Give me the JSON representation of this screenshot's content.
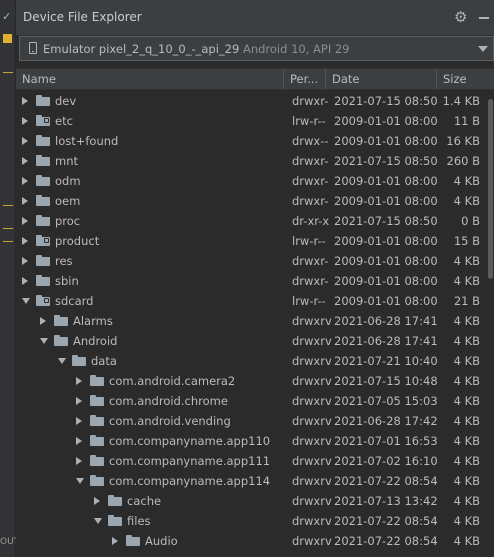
{
  "gutter": {
    "check": "✓",
    "out_label": "OUT"
  },
  "panel": {
    "title": "Device File Explorer",
    "gear_icon": "gear-icon",
    "hide_icon": "minimize-icon"
  },
  "device": {
    "name": "Emulator pixel_2_q_10_0_-_api_29",
    "subtitle": "Android 10, API 29"
  },
  "columns": {
    "name": "Name",
    "perm": "Per...",
    "date": "Date",
    "size": "Size"
  },
  "rows": [
    {
      "name": "dev",
      "perm": "drwxr-",
      "date": "2021-07-15 08:50",
      "size": "1.4 KB",
      "level": 0,
      "state": "collapsed",
      "link": false
    },
    {
      "name": "etc",
      "perm": "lrw-r--",
      "date": "2009-01-01 08:00",
      "size": "11 B",
      "level": 0,
      "state": "collapsed",
      "link": true
    },
    {
      "name": "lost+found",
      "perm": "drwx--",
      "date": "2009-01-01 08:00",
      "size": "16 KB",
      "level": 0,
      "state": "collapsed",
      "link": false
    },
    {
      "name": "mnt",
      "perm": "drwxr-",
      "date": "2021-07-15 08:50",
      "size": "260 B",
      "level": 0,
      "state": "collapsed",
      "link": false
    },
    {
      "name": "odm",
      "perm": "drwxr-",
      "date": "2009-01-01 08:00",
      "size": "4 KB",
      "level": 0,
      "state": "collapsed",
      "link": false
    },
    {
      "name": "oem",
      "perm": "drwxr-",
      "date": "2009-01-01 08:00",
      "size": "4 KB",
      "level": 0,
      "state": "collapsed",
      "link": false
    },
    {
      "name": "proc",
      "perm": "dr-xr-x",
      "date": "2021-07-15 08:50",
      "size": "0 B",
      "level": 0,
      "state": "collapsed",
      "link": false
    },
    {
      "name": "product",
      "perm": "lrw-r--",
      "date": "2009-01-01 08:00",
      "size": "15 B",
      "level": 0,
      "state": "collapsed",
      "link": true
    },
    {
      "name": "res",
      "perm": "drwxr-",
      "date": "2009-01-01 08:00",
      "size": "4 KB",
      "level": 0,
      "state": "collapsed",
      "link": false
    },
    {
      "name": "sbin",
      "perm": "drwxr-",
      "date": "2009-01-01 08:00",
      "size": "4 KB",
      "level": 0,
      "state": "collapsed",
      "link": false
    },
    {
      "name": "sdcard",
      "perm": "lrw-r--",
      "date": "2009-01-01 08:00",
      "size": "21 B",
      "level": 0,
      "state": "expanded",
      "link": true
    },
    {
      "name": "Alarms",
      "perm": "drwxrv",
      "date": "2021-06-28 17:41",
      "size": "4 KB",
      "level": 1,
      "state": "collapsed",
      "link": false
    },
    {
      "name": "Android",
      "perm": "drwxrv",
      "date": "2021-06-28 17:41",
      "size": "4 KB",
      "level": 1,
      "state": "expanded",
      "link": false
    },
    {
      "name": "data",
      "perm": "drwxrv",
      "date": "2021-07-21 10:40",
      "size": "4 KB",
      "level": 2,
      "state": "expanded",
      "link": false
    },
    {
      "name": "com.android.camera2",
      "perm": "drwxrv",
      "date": "2021-07-15 10:48",
      "size": "4 KB",
      "level": 3,
      "state": "collapsed",
      "link": false
    },
    {
      "name": "com.android.chrome",
      "perm": "drwxrv",
      "date": "2021-07-05 15:03",
      "size": "4 KB",
      "level": 3,
      "state": "collapsed",
      "link": false
    },
    {
      "name": "com.android.vending",
      "perm": "drwxrv",
      "date": "2021-06-28 17:42",
      "size": "4 KB",
      "level": 3,
      "state": "collapsed",
      "link": false
    },
    {
      "name": "com.companyname.app110",
      "perm": "drwxrv",
      "date": "2021-07-01 16:53",
      "size": "4 KB",
      "level": 3,
      "state": "collapsed",
      "link": false
    },
    {
      "name": "com.companyname.app111",
      "perm": "drwxrv",
      "date": "2021-07-02 16:10",
      "size": "4 KB",
      "level": 3,
      "state": "collapsed",
      "link": false
    },
    {
      "name": "com.companyname.app114",
      "perm": "drwxrv",
      "date": "2021-07-22 08:54",
      "size": "4 KB",
      "level": 3,
      "state": "expanded",
      "link": false
    },
    {
      "name": "cache",
      "perm": "drwxrv",
      "date": "2021-07-13 13:42",
      "size": "4 KB",
      "level": 4,
      "state": "collapsed",
      "link": false
    },
    {
      "name": "files",
      "perm": "drwxrv",
      "date": "2021-07-22 08:54",
      "size": "4 KB",
      "level": 4,
      "state": "expanded",
      "link": false
    },
    {
      "name": "Audio",
      "perm": "drwxrv",
      "date": "2021-07-22 08:54",
      "size": "4 KB",
      "level": 5,
      "state": "collapsed",
      "link": false
    }
  ]
}
